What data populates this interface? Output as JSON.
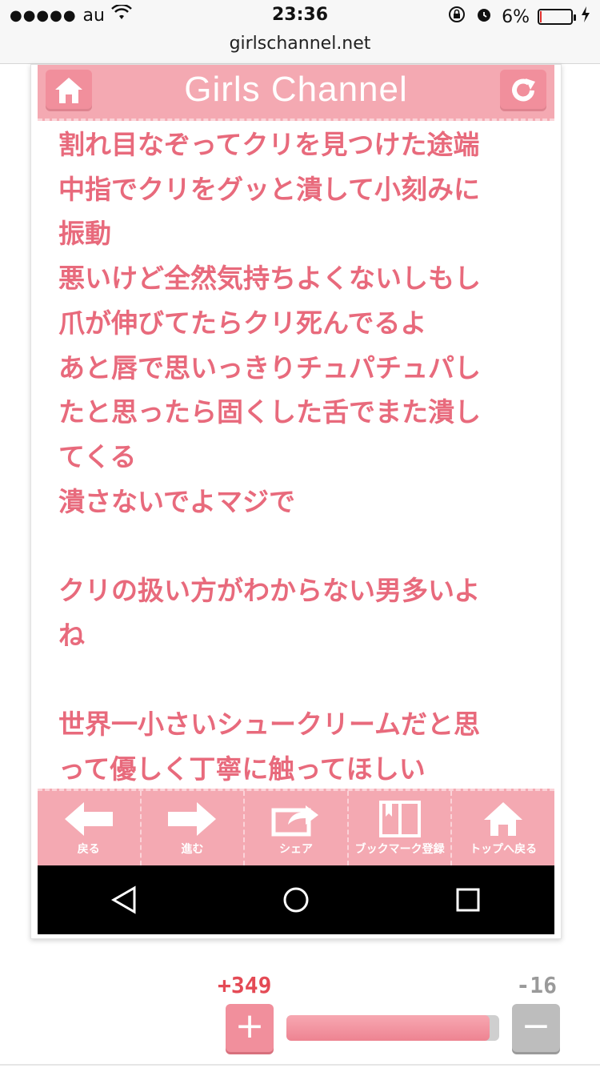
{
  "status_bar": {
    "signal": "●●●●●",
    "carrier": "au",
    "time": "23:36",
    "battery_percent": "6%",
    "battery_level": 0.06
  },
  "browser": {
    "url": "girlschannel.net"
  },
  "app": {
    "title": "Girls Channel",
    "comment_lines": [
      "割れ目なぞってクリを見つけた途端",
      "中指でクリをグッと潰して小刻みに",
      "振動",
      "悪いけど全然気持ちよくないしもし",
      "爪が伸びてたらクリ死んでるよ",
      "あと唇で思いっきりチュパチュパし",
      "たと思ったら固くした舌でまた潰し",
      "てくる",
      "潰さないでよマジで",
      "",
      "クリの扱い方がわからない男多いよ",
      "ね",
      "",
      "世界一小さいシュークリームだと思",
      "って優しく丁寧に触ってほしい"
    ],
    "bottom_nav": [
      {
        "label": "戻る",
        "icon": "arrow-left-icon"
      },
      {
        "label": "進む",
        "icon": "arrow-right-icon"
      },
      {
        "label": "シェア",
        "icon": "share-icon"
      },
      {
        "label": "ブックマーク登録",
        "icon": "bookmark-icon"
      },
      {
        "label": "トップへ戻る",
        "icon": "home-icon"
      }
    ]
  },
  "vote": {
    "plus_count": "+349",
    "minus_count": "-16",
    "plus_label": "+",
    "minus_label": "−",
    "plus_ratio": 0.956
  },
  "colors": {
    "accent": "#f4a9b2",
    "text": "#e86a7c",
    "plus": "#e44a55",
    "minus": "#bdbdbd"
  }
}
